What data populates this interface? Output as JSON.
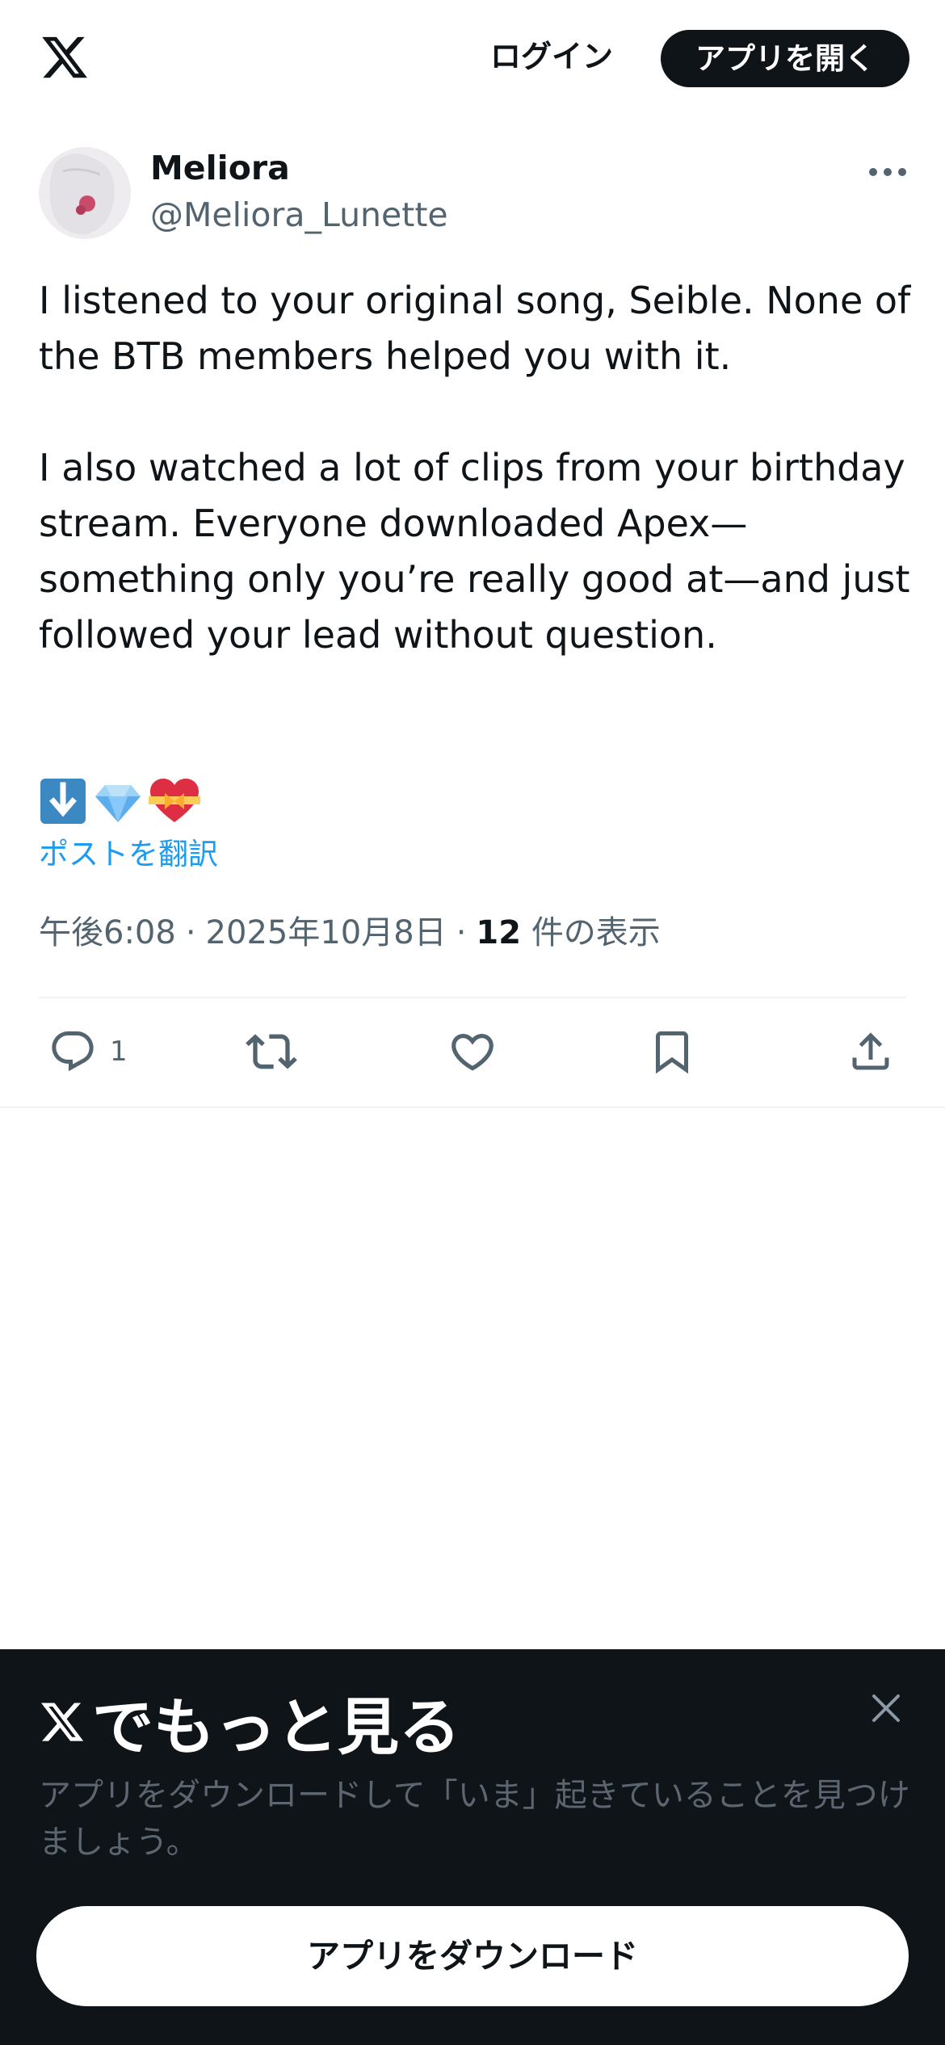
{
  "header": {
    "logo_icon": "x-logo-icon",
    "login_label": "ログイン",
    "open_app_label": "アプリを開く"
  },
  "tweet": {
    "display_name": "Meliora",
    "handle": "@Meliora_Lunette",
    "body": {
      "paragraph_1": "I listened to your original song, Seible. None of the BTB members helped you with it.",
      "paragraph_2": "I also watched a lot of clips from your birthday stream. Everyone downloaded Apex—something only you’re really good at—and just followed your lead without question."
    },
    "emojis": [
      "down-arrow-emoji",
      "gem-emoji",
      "heart-with-ribbon-emoji"
    ],
    "translate_label": "ポストを翻訳",
    "time": "午後6:08",
    "date": "2025年10月8日",
    "separator": "·",
    "view_count": "12",
    "view_label": "件の表示",
    "actions": {
      "reply_count": "1",
      "reply_icon": "reply-icon",
      "repost_icon": "repost-icon",
      "like_icon": "heart-icon",
      "bookmark_icon": "bookmark-icon",
      "share_icon": "share-icon"
    }
  },
  "promo": {
    "title_suffix": "でもっと見る",
    "description": "アプリをダウンロードして「いま」起きていることを見つけましょう。",
    "download_label": "アプリをダウンロード",
    "close_icon": "close-icon"
  },
  "colors": {
    "text_primary": "#0f1419",
    "text_secondary": "#536471",
    "link": "#1d9bf0",
    "promo_bg": "#0f1419",
    "divider": "#eff3f4"
  }
}
